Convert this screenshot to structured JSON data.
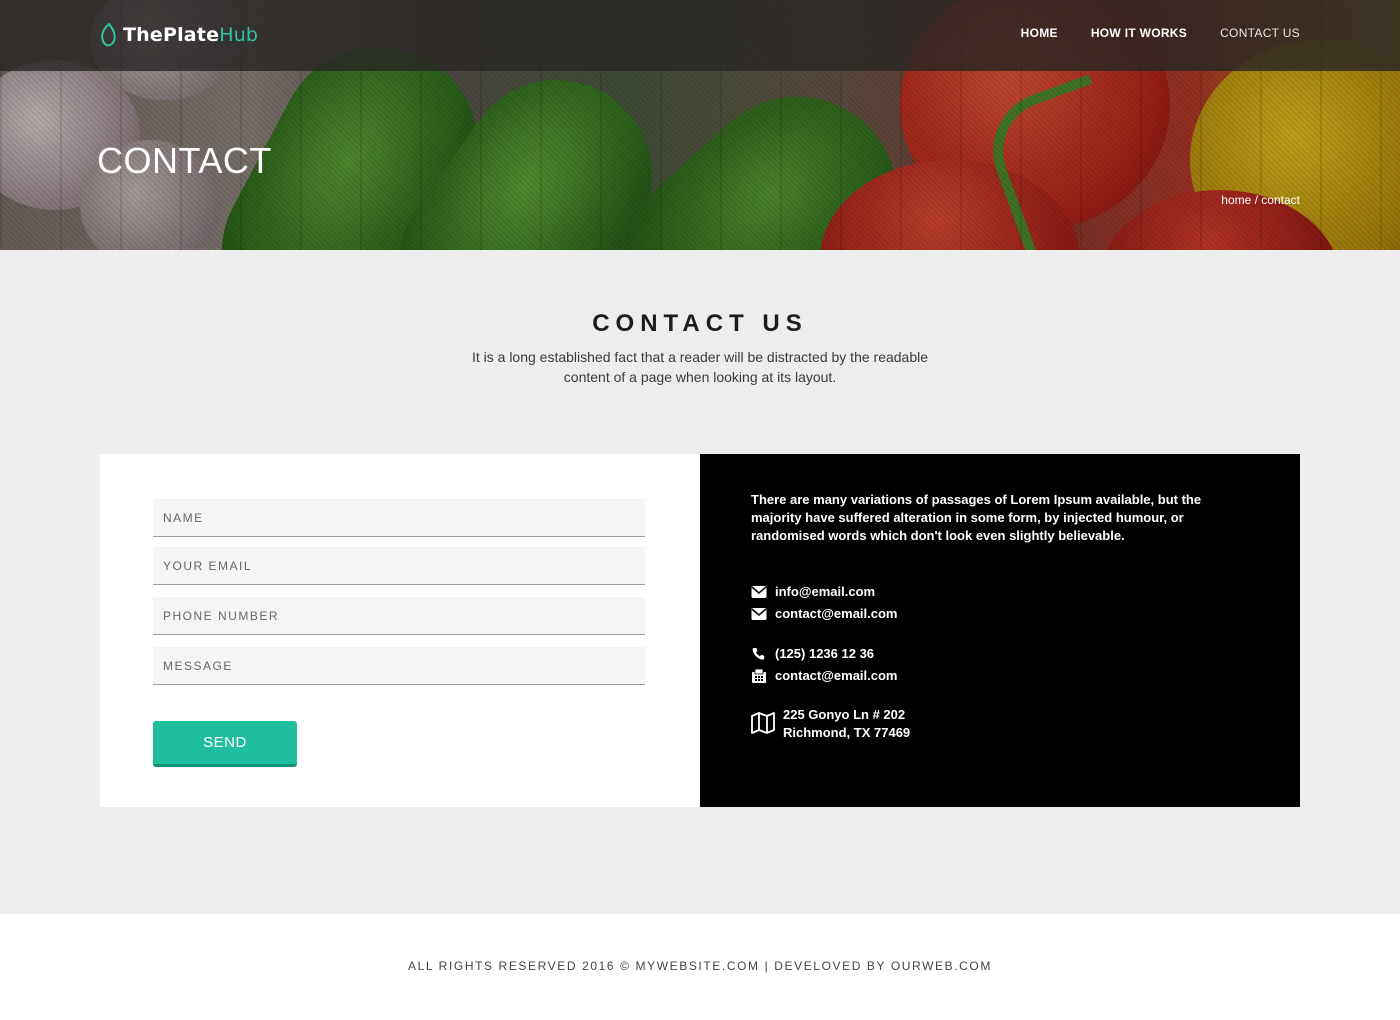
{
  "brand": {
    "name_part1": "ThePlate",
    "name_part2": "Hub",
    "accent": "#2dc3a3"
  },
  "nav": {
    "items": [
      {
        "label": "HOME"
      },
      {
        "label": "HOW IT WORKS"
      },
      {
        "label": "CONTACT US"
      }
    ]
  },
  "hero": {
    "title": "CONTACT",
    "breadcrumb": "home / contact"
  },
  "section": {
    "title": "CONTACT US",
    "description": "It is a long established fact that a reader will be distracted by the readable content of a page when looking at its layout."
  },
  "form": {
    "name_placeholder": "NAME",
    "email_placeholder": "YOUR EMAIL",
    "phone_placeholder": "PHONE NUMBER",
    "message_placeholder": "MESSAGE",
    "send_label": "SEND",
    "button_color": "#1fbf9d"
  },
  "info": {
    "text": "There are many variations of passages of Lorem Ipsum available, but the majority have suffered alteration in some form, by injected humour, or randomised words which don't look even slightly believable.",
    "email1": "info@email.com",
    "email2": "contact@email.com",
    "phone": "(125) 1236 12 36",
    "fax": "contact@email.com",
    "address_line1": "225 Gonyo Ln # 202",
    "address_line2": "Richmond, TX 77469",
    "icons": [
      "envelope-icon",
      "envelope-icon",
      "phone-icon",
      "fax-icon",
      "map-icon"
    ]
  },
  "footer": {
    "text": "ALL RIGHTS RESERVED 2016 © MYWEBSITE.COM | DEVELOVED BY OURWEB.COM"
  }
}
